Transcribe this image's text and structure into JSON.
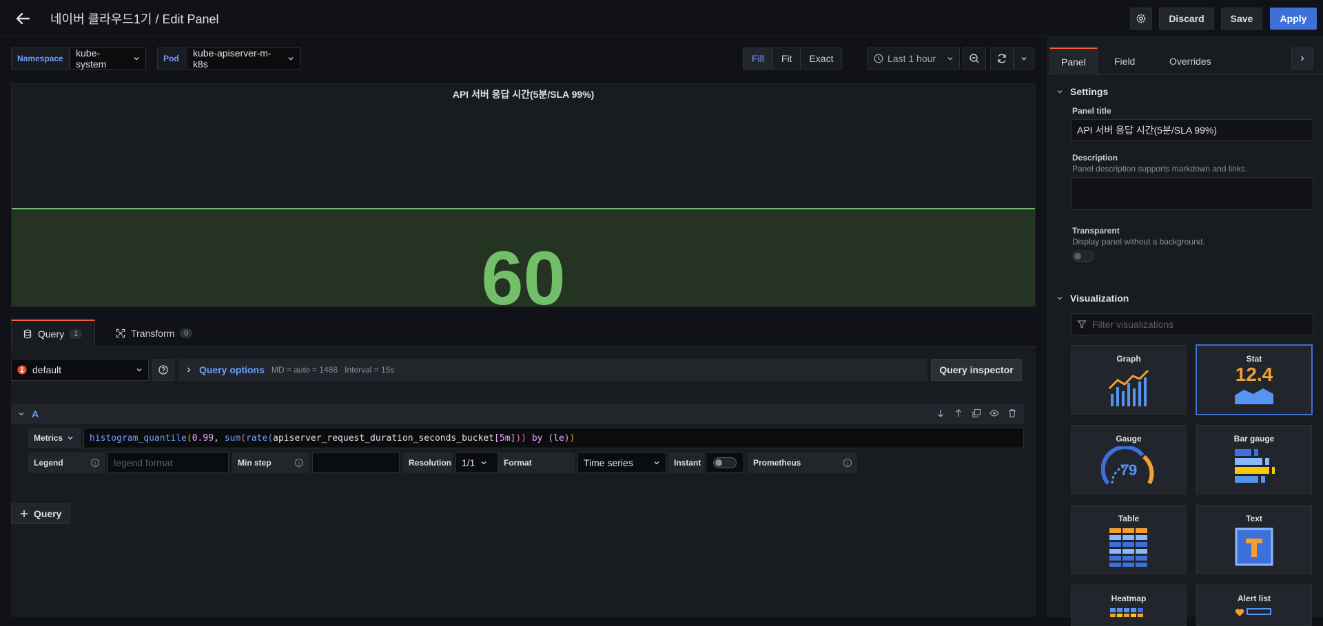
{
  "header": {
    "title": "네이버 클라우드1기 / Edit Panel",
    "discard_label": "Discard",
    "save_label": "Save",
    "apply_label": "Apply"
  },
  "variables": [
    {
      "label": "Namespace",
      "value": "kube-system"
    },
    {
      "label": "Pod",
      "value": "kube-apiserver-m-k8s"
    }
  ],
  "view_modes": {
    "options": [
      "Fill",
      "Fit",
      "Exact"
    ],
    "active": "Fill"
  },
  "time_range": "Last 1 hour",
  "panel": {
    "title": "API 서버 응답 시간(5분/SLA 99%)",
    "value": "60"
  },
  "query_tabs": [
    {
      "label": "Query",
      "count": "1"
    },
    {
      "label": "Transform",
      "count": "0"
    }
  ],
  "datasource": "default",
  "query_options": {
    "label": "Query options",
    "md": "MD = auto = 1488",
    "interval": "Interval = 15s"
  },
  "query_inspector_label": "Query inspector",
  "query": {
    "ref_id": "A",
    "metrics_label": "Metrics",
    "expr": {
      "fn1": "histogram_quantile",
      "p1": "(",
      "n1": "0.99",
      "comma": ", ",
      "fn2": "sum",
      "p2": "(",
      "fn3": "rate",
      "p3": "(",
      "metric": "apiserver_request_duration_seconds_bucket",
      "range": "[5m]",
      "p4": "))",
      "by": " by ",
      "group": "(le)",
      "p5": ")"
    },
    "legend_label": "Legend",
    "legend_placeholder": "legend format",
    "minstep_label": "Min step",
    "minstep_value": "",
    "resolution_label": "Resolution",
    "resolution_value": "1/1",
    "format_label": "Format",
    "format_value": "Time series",
    "instant_label": "Instant",
    "prometheus_label": "Prometheus"
  },
  "add_query_label": "Query",
  "options_pane": {
    "tabs": [
      "Panel",
      "Field",
      "Overrides"
    ],
    "active_tab": "Panel",
    "settings": {
      "heading": "Settings",
      "panel_title_label": "Panel title",
      "panel_title_value": "API 서버 응답 시간(5분/SLA 99%)",
      "description_label": "Description",
      "description_hint": "Panel description supports markdown and links.",
      "transparent_label": "Transparent",
      "transparent_hint": "Display panel without a background."
    },
    "visualization": {
      "heading": "Visualization",
      "filter_placeholder": "Filter visualizations",
      "items": [
        "Graph",
        "Stat",
        "Gauge",
        "Bar gauge",
        "Table",
        "Text",
        "Heatmap",
        "Alert list"
      ],
      "selected": "Stat",
      "stat_sample": "12.4",
      "gauge_sample": "79"
    }
  },
  "colors": {
    "accent_blue": "#3d71d9",
    "stat_green": "#73bf69",
    "tab_orange": "#f55f3e"
  }
}
